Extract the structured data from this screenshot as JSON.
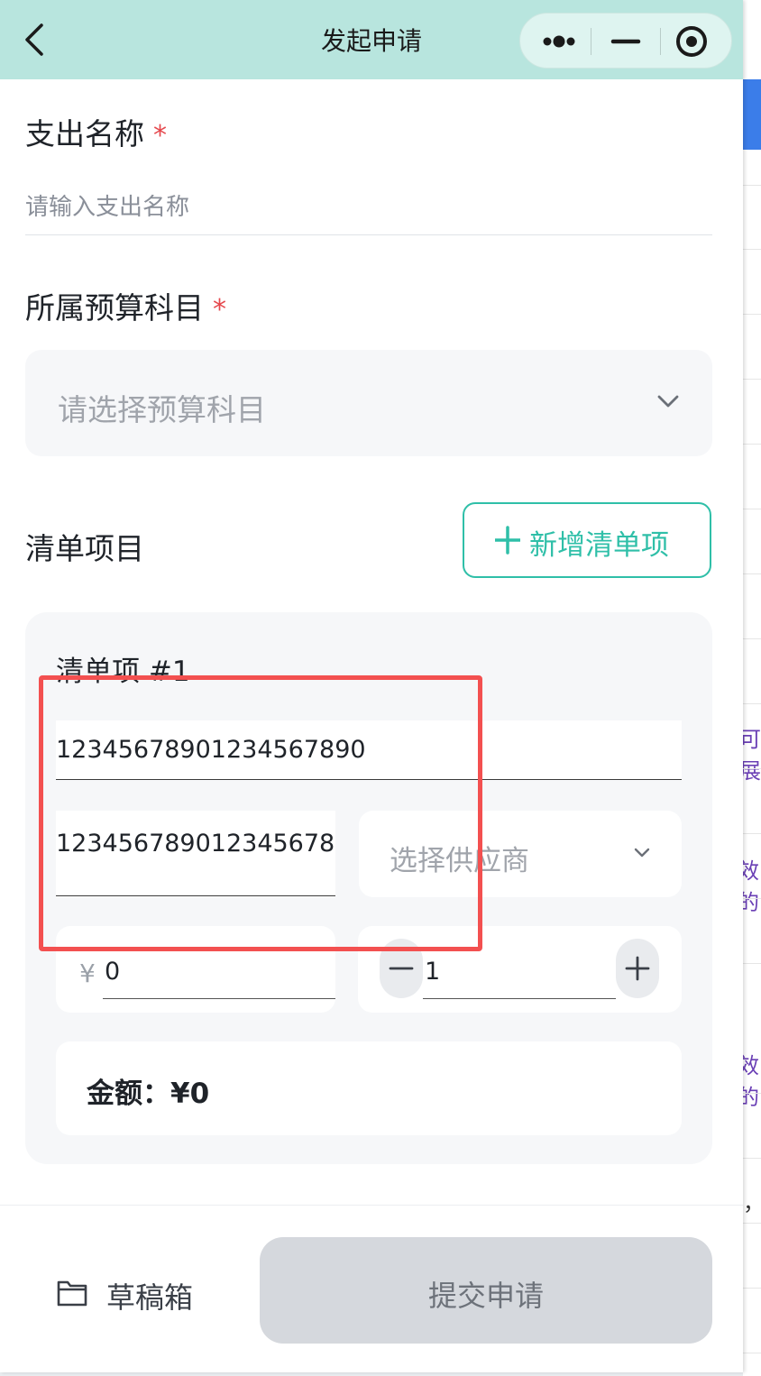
{
  "navbar": {
    "title": "发起申请",
    "bg_color": "#b8e5de"
  },
  "form": {
    "expense_name": {
      "label": "支出名称",
      "required_mark": "*",
      "placeholder": "请输入支出名称",
      "value": ""
    },
    "budget_subject": {
      "label": "所属预算科目",
      "required_mark": "*",
      "placeholder": "请选择预算科目"
    },
    "list_section": {
      "label": "清单项目",
      "add_button": "新增清单项",
      "accent_color": "#2fbfa8"
    },
    "item": {
      "title": "清单项 #1",
      "name_value": "12345678901234567890",
      "spec_value": "123456789012345678",
      "supplier_placeholder": "选择供应商",
      "currency_symbol": "¥",
      "price_value": "0",
      "quantity_value": "1",
      "amount_label": "金额：¥0"
    }
  },
  "bottom": {
    "draft_label": "草稿箱",
    "submit_label": "提交申请"
  },
  "background_window": {
    "fragments": [
      "可展",
      "效的",
      "效的",
      "，"
    ]
  }
}
